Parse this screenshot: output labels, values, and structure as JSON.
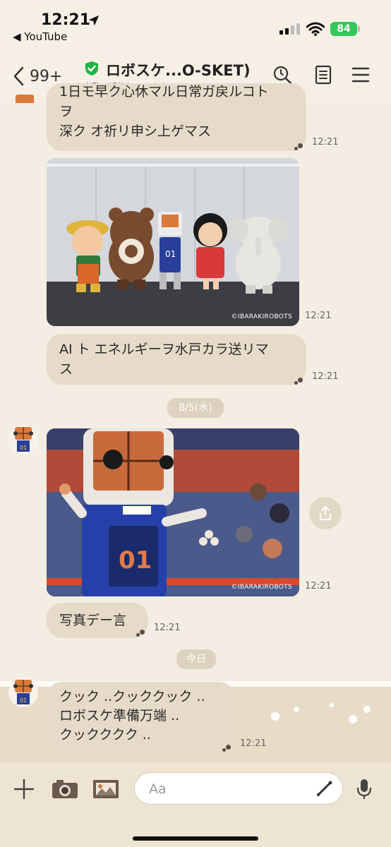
{
  "status_bar": {
    "time": "12:21",
    "back_app": "◀ YouTube",
    "battery": "84"
  },
  "header": {
    "back_count": "99+",
    "title": "ロボスケ...O-SKET)",
    "subtitle": "自動で返信しています"
  },
  "messages": {
    "m1_line1": "1日モ早ク心休マル日常ガ戻ルコト",
    "m1_line2": "ヲ",
    "m1_line3": "深ク オ祈リ申シ上ゲマス",
    "m1_time": "12:21",
    "photo1_credit": "©IBARAKIROBOTS",
    "photo1_time": "12:21",
    "m2_line1": "AI ト エネルギーヲ水戸カラ送リマ",
    "m2_line2": "ス",
    "m2_time": "12:21",
    "date1": "8/5(水)",
    "photo2_credit": "©IBARAKIROBOTS",
    "photo2_time": "12:21",
    "m3": "写真デー言",
    "m3_time": "12:21",
    "date2": "今日",
    "m4_line1": "クック ..クッククック ..",
    "m4_line2": "ロボスケ準備万端 ..",
    "m4_line3": "クックククク ..",
    "m4_time": "12:21"
  },
  "input": {
    "placeholder": "Aa"
  }
}
